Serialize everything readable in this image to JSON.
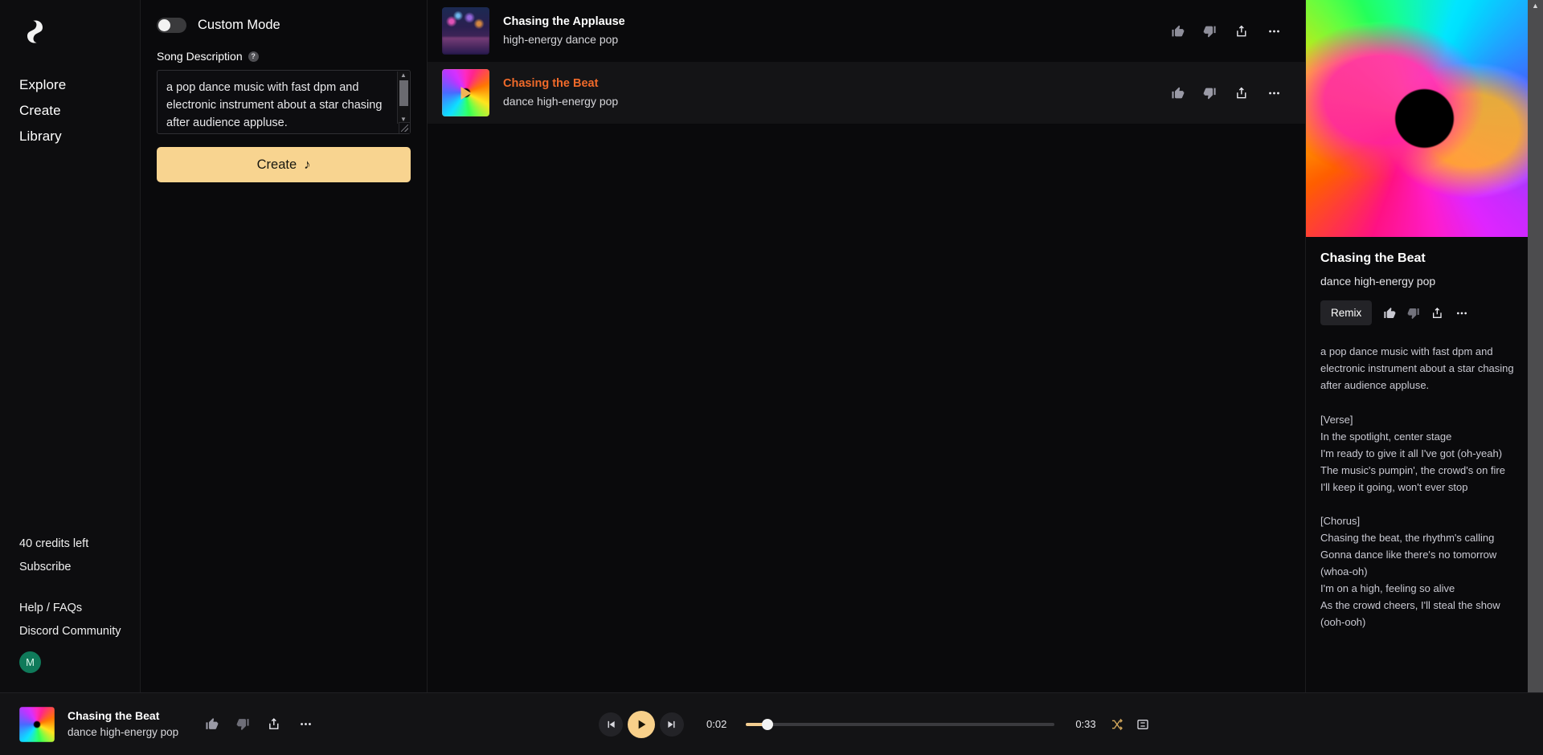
{
  "brand": {
    "logo_name": "suno-logo"
  },
  "sidebar": {
    "links": [
      {
        "label": "Explore",
        "name": "sidebar-item-explore"
      },
      {
        "label": "Create",
        "name": "sidebar-item-create"
      },
      {
        "label": "Library",
        "name": "sidebar-item-library"
      }
    ],
    "credits": "40 credits left",
    "subscribe": "Subscribe",
    "help": "Help / FAQs",
    "discord": "Discord Community",
    "avatar_initial": "M"
  },
  "create_panel": {
    "custom_mode_label": "Custom Mode",
    "custom_mode_on": false,
    "song_description_label": "Song Description",
    "help_glyph": "?",
    "description_value": "a pop dance music with fast dpm and electronic instrument about a star chasing after audience appluse.",
    "create_label": "Create",
    "create_icon": "music-note-icon"
  },
  "song_list": [
    {
      "title": "Chasing the Applause",
      "subtitle": "high-energy dance pop",
      "artwork": "neon-city-skyline",
      "selected": false,
      "playing": false
    },
    {
      "title": "Chasing the Beat",
      "subtitle": "dance high-energy pop",
      "artwork": "rainbow-swirl",
      "selected": true,
      "playing": true
    }
  ],
  "row_actions": [
    {
      "name": "thumbs-up-icon",
      "label": "Like"
    },
    {
      "name": "thumbs-down-icon",
      "label": "Dislike"
    },
    {
      "name": "share-icon",
      "label": "Share"
    },
    {
      "name": "more-options-icon",
      "label": "More"
    }
  ],
  "detail": {
    "artwork": "rainbow-swirl-large",
    "title": "Chasing the Beat",
    "subtitle": "dance high-energy pop",
    "remix_label": "Remix",
    "description": "a pop dance music with fast dpm and electronic instrument about a star chasing after audience appluse.",
    "lyrics": "[Verse]\nIn the spotlight, center stage\nI'm ready to give it all I've got (oh-yeah)\nThe music's pumpin', the crowd's on fire\nI'll keep it going, won't ever stop\n\n[Chorus]\nChasing the beat, the rhythm's calling\nGonna dance like there's no tomorrow\n(whoa-oh)\nI'm on a high, feeling so alive\nAs the crowd cheers, I'll steal the show\n(ooh-ooh)"
  },
  "player": {
    "title": "Chasing the Beat",
    "subtitle": "dance high-energy pop",
    "current_time": "0:02",
    "total_time": "0:33",
    "progress_percent": 2,
    "is_playing": true,
    "shuffle_active": true,
    "repeat_active": false
  },
  "colors": {
    "accent": "#f8d490",
    "active_track": "#f06a2a",
    "bg": "#0a0a0c",
    "row_alt": "#141416"
  }
}
